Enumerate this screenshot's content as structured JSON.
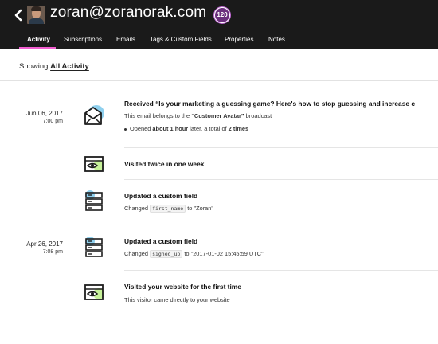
{
  "header": {
    "email": "zoran@zoranorak.com",
    "score": "120"
  },
  "tabs": [
    {
      "label": "Activity"
    },
    {
      "label": "Subscriptions"
    },
    {
      "label": "Emails"
    },
    {
      "label": "Tags & Custom Fields"
    },
    {
      "label": "Properties"
    },
    {
      "label": "Notes"
    }
  ],
  "filter": {
    "prefix": "Showing ",
    "value": "All Activity"
  },
  "activities": [
    {
      "date": "Jun 06, 2017",
      "time": "7:00 pm",
      "icon": "email-icon",
      "title": "Received “Is your marketing a guessing game? Here's how to stop guessing and increase c",
      "desc_prefix": "This email belongs to the ",
      "desc_link": "“Customer Avatar”",
      "desc_suffix": " broadcast",
      "bullet_prefix": "Opened ",
      "bullet_time": "about 1 hour",
      "bullet_mid": " later, a total of ",
      "bullet_count": "2 times"
    },
    {
      "icon": "eye-browser-icon",
      "title": "Visited twice in one week"
    },
    {
      "icon": "database-icon",
      "title": "Updated a custom field",
      "desc_prefix": "Changed ",
      "desc_code": "first_name",
      "desc_suffix": " to \"Zoran\""
    },
    {
      "date": "Apr 26, 2017",
      "time": "7:08 pm",
      "icon": "database-icon",
      "title": "Updated a custom field",
      "desc_prefix": "Changed ",
      "desc_code": "signed_up",
      "desc_suffix": " to \"2017-01-02 15:45:59 UTC\""
    },
    {
      "icon": "eye-browser-icon",
      "title": "Visited your website for the first time",
      "desc": "This visitor came directly to your website"
    }
  ],
  "colors": {
    "header_bg": "#1a1a1a",
    "active_tab_underline": "#f25ed0",
    "score_badge": "#6b2f7d",
    "icon_accent_blue": "#8fd0ee",
    "icon_accent_green": "#c7f29a"
  }
}
